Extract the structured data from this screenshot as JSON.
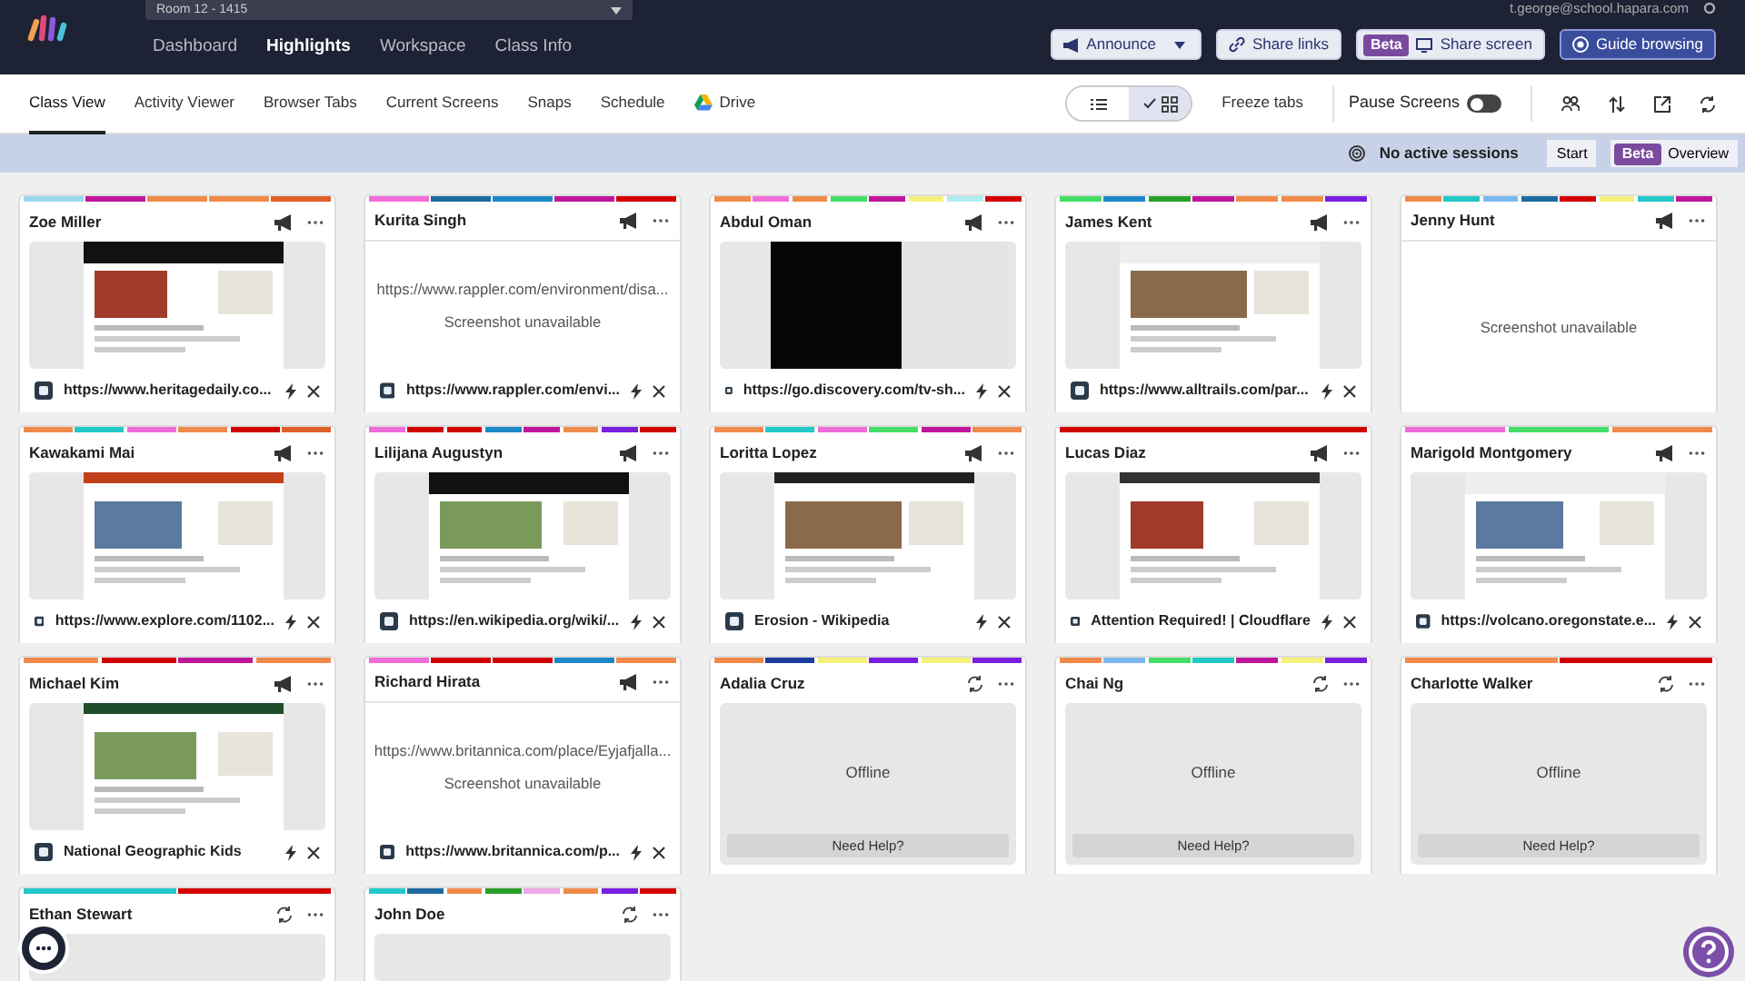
{
  "room_selector": {
    "label": "Room 12 - 1415"
  },
  "account": {
    "email": "t.george@school.hapara.com"
  },
  "main_nav": [
    {
      "label": "Dashboard",
      "selected": false
    },
    {
      "label": "Highlights",
      "selected": true
    },
    {
      "label": "Workspace",
      "selected": false
    },
    {
      "label": "Class Info",
      "selected": false
    }
  ],
  "header_buttons": [
    {
      "kind": "dropdown",
      "label": "Announce"
    },
    {
      "kind": "plain",
      "label": "Share links"
    },
    {
      "kind": "beta",
      "badge": "Beta",
      "label": "Share screen"
    },
    {
      "kind": "primary",
      "label": "Guide browsing"
    }
  ],
  "view_tabs": [
    {
      "label": "Class View",
      "selected": true,
      "kind": "text"
    },
    {
      "label": "Activity Viewer",
      "selected": false,
      "kind": "text"
    },
    {
      "label": "Browser Tabs",
      "selected": false,
      "kind": "text"
    },
    {
      "label": "Current Screens",
      "selected": false,
      "kind": "text"
    },
    {
      "label": "Snaps",
      "selected": false,
      "kind": "text"
    },
    {
      "label": "Schedule",
      "selected": false,
      "kind": "text"
    },
    {
      "label": "Drive",
      "selected": false,
      "kind": "drive"
    }
  ],
  "view_toggle": [
    {
      "kind": "list",
      "selected": false
    },
    {
      "kind": "grid",
      "selected": true
    }
  ],
  "freeze_tabs": "Freeze tabs",
  "pause_screens": {
    "label": "Pause Screens",
    "on": false
  },
  "sessions_bar": {
    "status": "No active sessions",
    "start": "Start",
    "badge": "Beta",
    "overview": "Overview"
  },
  "students": [
    {
      "name": "Zoe Miller",
      "kind": "screenshot",
      "url": "https://www.heritagedaily.co...",
      "tabs": [
        {
          "color": "#9ad8f0"
        },
        {
          "color": "#c0169b"
        },
        {
          "color": "#f08a4b"
        },
        {
          "color": "#f08a4b"
        },
        {
          "color": "#e0602a"
        }
      ]
    },
    {
      "name": "Kurita Singh",
      "kind": "unavailable",
      "page_url": "https://www.rappler.com/environment/disa...",
      "message": "Screenshot unavailable",
      "url": "https://www.rappler.com/envi...",
      "tabs": [
        {
          "color": "#f06cd8"
        },
        {
          "color": "#1c6aa0"
        },
        {
          "color": "#1c88c8"
        },
        {
          "color": "#c0169b"
        },
        {
          "color": "#d40000"
        }
      ]
    },
    {
      "name": "Abdul Oman",
      "kind": "screenshot",
      "url": "https://go.discovery.com/tv-sh...",
      "tabs": [
        {
          "color": "#f08a4b"
        },
        {
          "color": "#f06cd8"
        },
        {
          "color": "#f08a4b"
        },
        {
          "color": "#44dd66"
        },
        {
          "color": "#c0169b"
        },
        {
          "color": "#f5f07a"
        },
        {
          "color": "#b0ecf0"
        },
        {
          "color": "#d40000"
        }
      ]
    },
    {
      "name": "James Kent",
      "kind": "screenshot",
      "url": "https://www.alltrails.com/par...",
      "tabs": [
        {
          "color": "#44dd66"
        },
        {
          "color": "#1c88c8"
        },
        {
          "color": "#2aa02a"
        },
        {
          "color": "#c0169b"
        },
        {
          "color": "#f08a4b"
        },
        {
          "color": "#f08a4b"
        },
        {
          "color": "#7a1ee0"
        }
      ]
    },
    {
      "name": "Jenny Hunt",
      "kind": "unavailable",
      "message": "Screenshot unavailable",
      "tabs": [
        {
          "color": "#f08a4b"
        },
        {
          "color": "#20c8c8"
        },
        {
          "color": "#7ab8f0"
        },
        {
          "color": "#1c6aa0"
        },
        {
          "color": "#d40000"
        },
        {
          "color": "#f5f07a"
        },
        {
          "color": "#20c8c8"
        },
        {
          "color": "#c0169b"
        }
      ]
    },
    {
      "name": "Kawakami Mai",
      "kind": "screenshot",
      "url": "https://www.explore.com/1102...",
      "tabs": [
        {
          "color": "#f08a4b"
        },
        {
          "color": "#20c8c8"
        },
        {
          "color": "#f06cd8"
        },
        {
          "color": "#f08a4b"
        },
        {
          "color": "#d40000"
        },
        {
          "color": "#e0602a"
        }
      ]
    },
    {
      "name": "Lilijana Augustyn",
      "kind": "screenshot",
      "url": "https://en.wikipedia.org/wiki/...",
      "tabs": [
        {
          "color": "#f06cd8"
        },
        {
          "color": "#d40000"
        },
        {
          "color": "#d40000"
        },
        {
          "color": "#1c88c8"
        },
        {
          "color": "#c0169b"
        },
        {
          "color": "#f08a4b"
        },
        {
          "color": "#7a1ee0"
        },
        {
          "color": "#d40000"
        }
      ]
    },
    {
      "name": "Loritta Lopez",
      "kind": "screenshot",
      "url": "Erosion - Wikipedia",
      "tabs": [
        {
          "color": "#f08a4b"
        },
        {
          "color": "#20c8c8"
        },
        {
          "color": "#f06cd8"
        },
        {
          "color": "#44dd66"
        },
        {
          "color": "#c0169b"
        },
        {
          "color": "#f08a4b"
        }
      ]
    },
    {
      "name": "Lucas Diaz",
      "kind": "screenshot",
      "url": "Attention Required! | Cloudflare",
      "tabs": [
        {
          "color": "#d40000"
        }
      ]
    },
    {
      "name": "Marigold Montgomery",
      "kind": "screenshot",
      "url": "https://volcano.oregonstate.e...",
      "tabs": [
        {
          "color": "#f06cd8"
        },
        {
          "color": "#44dd66"
        },
        {
          "color": "#f08a4b"
        }
      ]
    },
    {
      "name": "Michael Kim",
      "kind": "screenshot",
      "url": "National Geographic Kids",
      "tabs": [
        {
          "color": "#f08a4b"
        },
        {
          "color": "#d40000"
        },
        {
          "color": "#c0169b"
        },
        {
          "color": "#f08a4b"
        }
      ]
    },
    {
      "name": "Richard Hirata",
      "kind": "unavailable",
      "page_url": "https://www.britannica.com/place/Eyjafjalla...",
      "message": "Screenshot unavailable",
      "url": "https://www.britannica.com/p...",
      "tabs": [
        {
          "color": "#f06cd8"
        },
        {
          "color": "#d40000"
        },
        {
          "color": "#d40000"
        },
        {
          "color": "#1c88c8"
        },
        {
          "color": "#f08a4b"
        }
      ]
    },
    {
      "name": "Adalia Cruz",
      "kind": "offline",
      "status": "Offline",
      "help_button": "Need Help?",
      "tabs": [
        {
          "color": "#f08a4b"
        },
        {
          "color": "#1c3ca0"
        },
        {
          "color": "#f5f07a"
        },
        {
          "color": "#7a1ee0"
        },
        {
          "color": "#f5f07a"
        },
        {
          "color": "#7a1ee0"
        }
      ]
    },
    {
      "name": "Chai Ng",
      "kind": "offline",
      "status": "Offline",
      "help_button": "Need Help?",
      "tabs": [
        {
          "color": "#f08a4b"
        },
        {
          "color": "#7ab8f0"
        },
        {
          "color": "#44dd66"
        },
        {
          "color": "#20c8c8"
        },
        {
          "color": "#c0169b"
        },
        {
          "color": "#f5f07a"
        },
        {
          "color": "#7a1ee0"
        }
      ]
    },
    {
      "name": "Charlotte Walker",
      "kind": "offline",
      "status": "Offline",
      "help_button": "Need Help?",
      "tabs": [
        {
          "color": "#f08a4b"
        },
        {
          "color": "#d40000"
        }
      ]
    },
    {
      "name": "Ethan Stewart",
      "kind": "offline",
      "tabs": [
        {
          "color": "#20c8c8"
        },
        {
          "color": "#d40000"
        }
      ]
    },
    {
      "name": "John Doe",
      "kind": "offline",
      "tabs": [
        {
          "color": "#20c8c8"
        },
        {
          "color": "#1c6aa0"
        },
        {
          "color": "#f08a4b"
        },
        {
          "color": "#2aa02a"
        },
        {
          "color": "#f0a8e8"
        },
        {
          "color": "#f08a4b"
        },
        {
          "color": "#7a1ee0"
        },
        {
          "color": "#d40000"
        }
      ]
    }
  ]
}
